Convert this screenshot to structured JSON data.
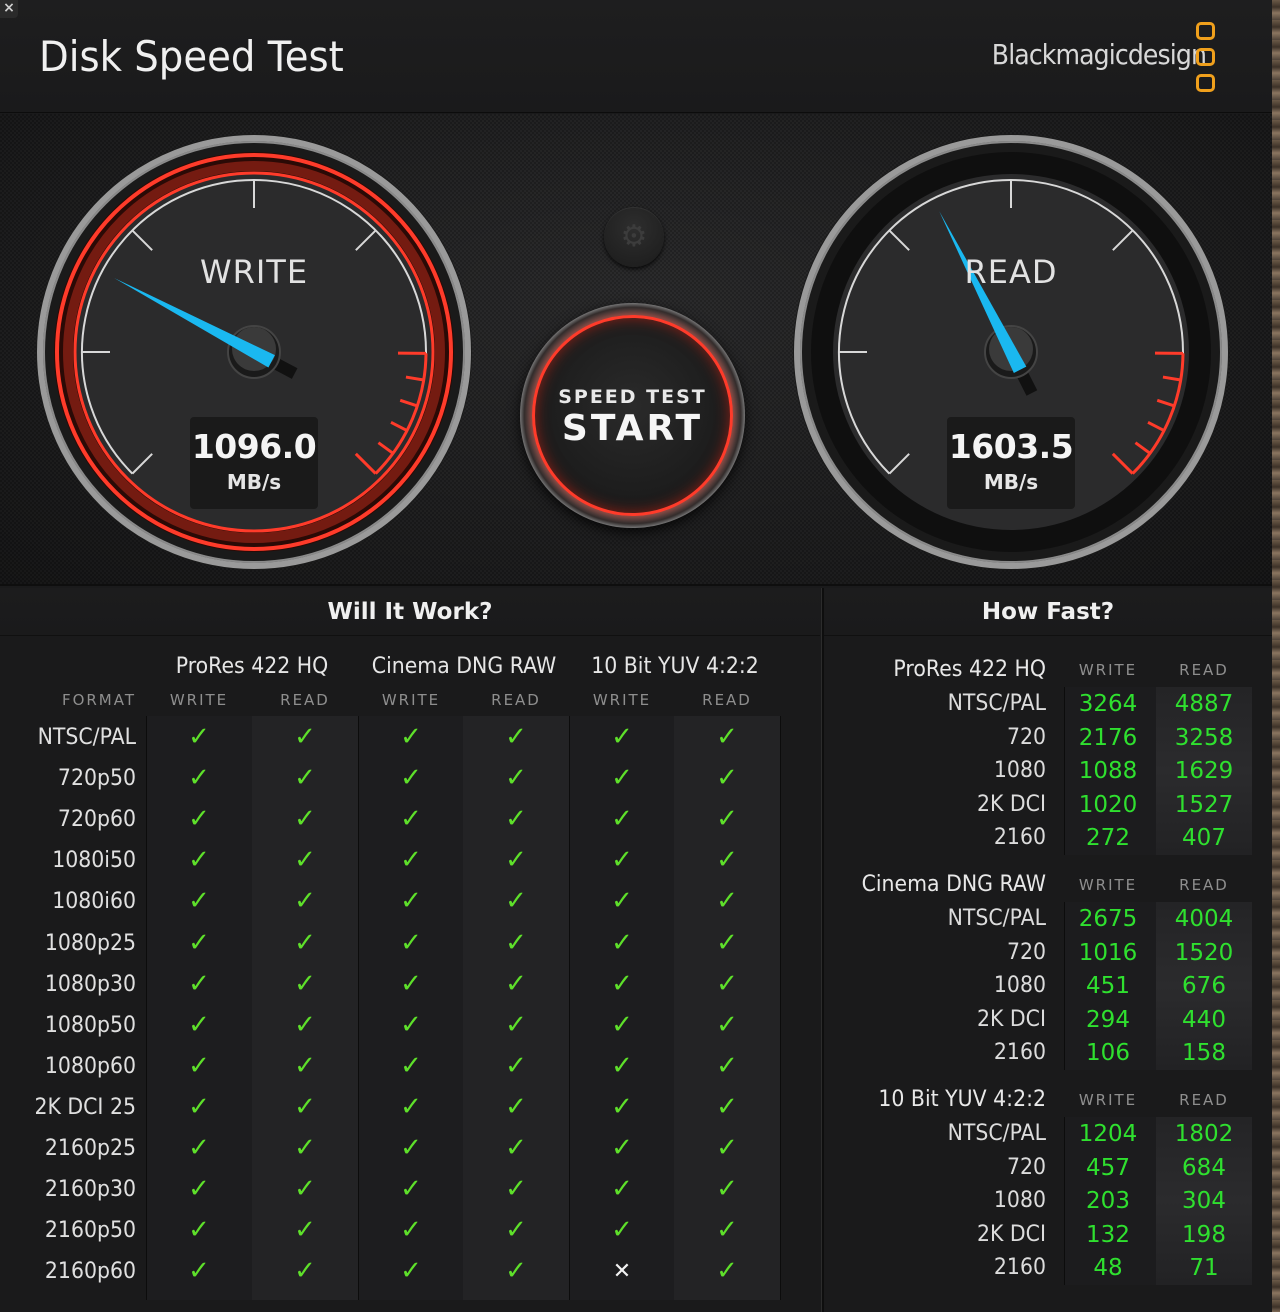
{
  "window": {
    "title": "Disk Speed Test",
    "close_icon": "close-icon",
    "brand": "Blackmagicdesign",
    "brand_color": "#f0a01c"
  },
  "gauges": {
    "write": {
      "label": "WRITE",
      "value": "1096.0",
      "unit": "MB/s",
      "needle_fraction": 0.27,
      "needle_color": "#1ab8f0",
      "ring_color": "#ff3b2a",
      "active": true
    },
    "read": {
      "label": "READ",
      "value": "1603.5",
      "unit": "MB/s",
      "needle_fraction": 0.4,
      "needle_color": "#1ab8f0",
      "active": false
    },
    "redline_color": "#ff3b2a"
  },
  "controls": {
    "settings_icon": "gear-icon",
    "start_small": "SPEED TEST",
    "start_big": "START"
  },
  "will_it_work": {
    "title": "Will It Work?",
    "format_label": "FORMAT",
    "codecs": [
      "ProRes 422 HQ",
      "Cinema DNG RAW",
      "10 Bit YUV 4:2:2"
    ],
    "sub_headers": [
      "WRITE",
      "READ",
      "WRITE",
      "READ",
      "WRITE",
      "READ"
    ],
    "rows": [
      {
        "format": "NTSC/PAL",
        "results": [
          true,
          true,
          true,
          true,
          true,
          true
        ]
      },
      {
        "format": "720p50",
        "results": [
          true,
          true,
          true,
          true,
          true,
          true
        ]
      },
      {
        "format": "720p60",
        "results": [
          true,
          true,
          true,
          true,
          true,
          true
        ]
      },
      {
        "format": "1080i50",
        "results": [
          true,
          true,
          true,
          true,
          true,
          true
        ]
      },
      {
        "format": "1080i60",
        "results": [
          true,
          true,
          true,
          true,
          true,
          true
        ]
      },
      {
        "format": "1080p25",
        "results": [
          true,
          true,
          true,
          true,
          true,
          true
        ]
      },
      {
        "format": "1080p30",
        "results": [
          true,
          true,
          true,
          true,
          true,
          true
        ]
      },
      {
        "format": "1080p50",
        "results": [
          true,
          true,
          true,
          true,
          true,
          true
        ]
      },
      {
        "format": "1080p60",
        "results": [
          true,
          true,
          true,
          true,
          true,
          true
        ]
      },
      {
        "format": "2K DCI 25",
        "results": [
          true,
          true,
          true,
          true,
          true,
          true
        ]
      },
      {
        "format": "2160p25",
        "results": [
          true,
          true,
          true,
          true,
          true,
          true
        ]
      },
      {
        "format": "2160p30",
        "results": [
          true,
          true,
          true,
          true,
          true,
          true
        ]
      },
      {
        "format": "2160p50",
        "results": [
          true,
          true,
          true,
          true,
          true,
          true
        ]
      },
      {
        "format": "2160p60",
        "results": [
          true,
          true,
          true,
          true,
          false,
          true
        ]
      }
    ],
    "pass_glyph": "✓",
    "fail_glyph": "✕",
    "pass_color": "#5ee02a"
  },
  "how_fast": {
    "title": "How Fast?",
    "write_label": "WRITE",
    "read_label": "READ",
    "value_color": "#2fe02f",
    "groups": [
      {
        "codec": "ProRes 422 HQ",
        "rows": [
          {
            "format": "NTSC/PAL",
            "write": "3264",
            "read": "4887"
          },
          {
            "format": "720",
            "write": "2176",
            "read": "3258"
          },
          {
            "format": "1080",
            "write": "1088",
            "read": "1629"
          },
          {
            "format": "2K DCI",
            "write": "1020",
            "read": "1527"
          },
          {
            "format": "2160",
            "write": "272",
            "read": "407"
          }
        ]
      },
      {
        "codec": "Cinema DNG RAW",
        "rows": [
          {
            "format": "NTSC/PAL",
            "write": "2675",
            "read": "4004"
          },
          {
            "format": "720",
            "write": "1016",
            "read": "1520"
          },
          {
            "format": "1080",
            "write": "451",
            "read": "676"
          },
          {
            "format": "2K DCI",
            "write": "294",
            "read": "440"
          },
          {
            "format": "2160",
            "write": "106",
            "read": "158"
          }
        ]
      },
      {
        "codec": "10 Bit YUV 4:2:2",
        "rows": [
          {
            "format": "NTSC/PAL",
            "write": "1204",
            "read": "1802"
          },
          {
            "format": "720",
            "write": "457",
            "read": "684"
          },
          {
            "format": "1080",
            "write": "203",
            "read": "304"
          },
          {
            "format": "2K DCI",
            "write": "132",
            "read": "198"
          },
          {
            "format": "2160",
            "write": "48",
            "read": "71"
          }
        ]
      }
    ]
  }
}
